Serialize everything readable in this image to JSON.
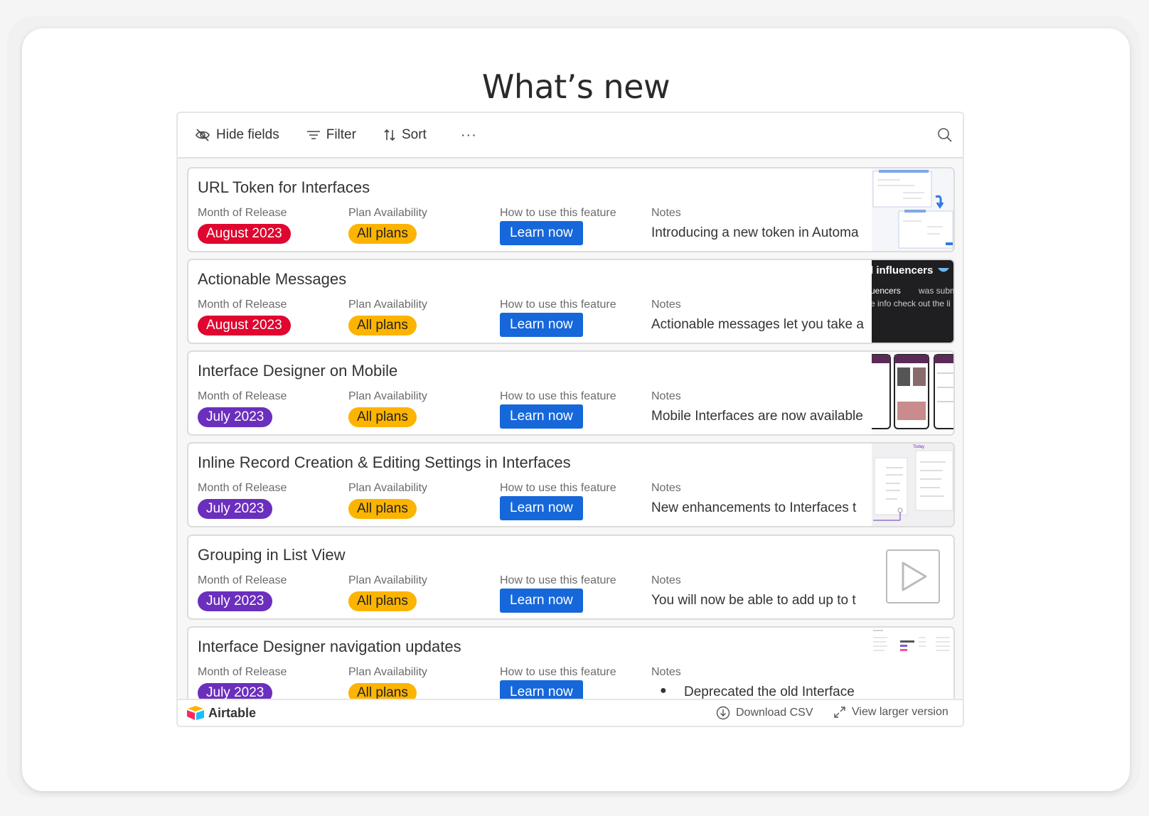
{
  "page_title": "What’s new",
  "toolbar": {
    "hide_fields": "Hide fields",
    "filter": "Filter",
    "sort": "Sort",
    "more": "···"
  },
  "field_labels": {
    "month": "Month of Release",
    "plan": "Plan Availability",
    "howto": "How to use this feature",
    "notes": "Notes"
  },
  "records": [
    {
      "title": "URL Token for Interfaces",
      "month": "August 2023",
      "month_color": "#e0062f",
      "plan": "All plans",
      "button": "Learn now",
      "notes": "Introducing a new token in Automa",
      "thumb": "screenshot-ui"
    },
    {
      "title": "Actionable Messages",
      "month": "August 2023",
      "month_color": "#e0062f",
      "plan": "All plans",
      "button": "Learn now",
      "notes": "Actionable messages let you take a",
      "thumb": "dark-message",
      "thumb_text_1": "l influencers",
      "thumb_text_2": "uencers",
      "thumb_text_3": "was subm",
      "thumb_text_4": "e info check out the li"
    },
    {
      "title": "Interface Designer on Mobile",
      "month": "July 2023",
      "month_color": "#6b2fbd",
      "plan": "All plans",
      "button": "Learn now",
      "notes": "Mobile Interfaces are now available",
      "thumb": "phones"
    },
    {
      "title": "Inline Record Creation & Editing Settings in Interfaces",
      "month": "July 2023",
      "month_color": "#6b2fbd",
      "plan": "All plans",
      "button": "Learn now",
      "notes": "New enhancements to Interfaces t",
      "thumb": "panels",
      "thumb_text_1": "Today"
    },
    {
      "title": "Grouping in List View",
      "month": "July 2023",
      "month_color": "#6b2fbd",
      "plan": "All plans",
      "button": "Learn now",
      "notes": "You will now be able to add up to t",
      "thumb": "video-play"
    },
    {
      "title": "Interface Designer navigation updates",
      "month": "July 2023",
      "month_color": "#6b2fbd",
      "plan": "All plans",
      "button": "Learn now",
      "notes": "Deprecated the old Interface",
      "notes_bullet": "●",
      "thumb": "table-mini"
    }
  ],
  "footer": {
    "brand": "Airtable",
    "download": "Download CSV",
    "larger": "View larger version"
  }
}
